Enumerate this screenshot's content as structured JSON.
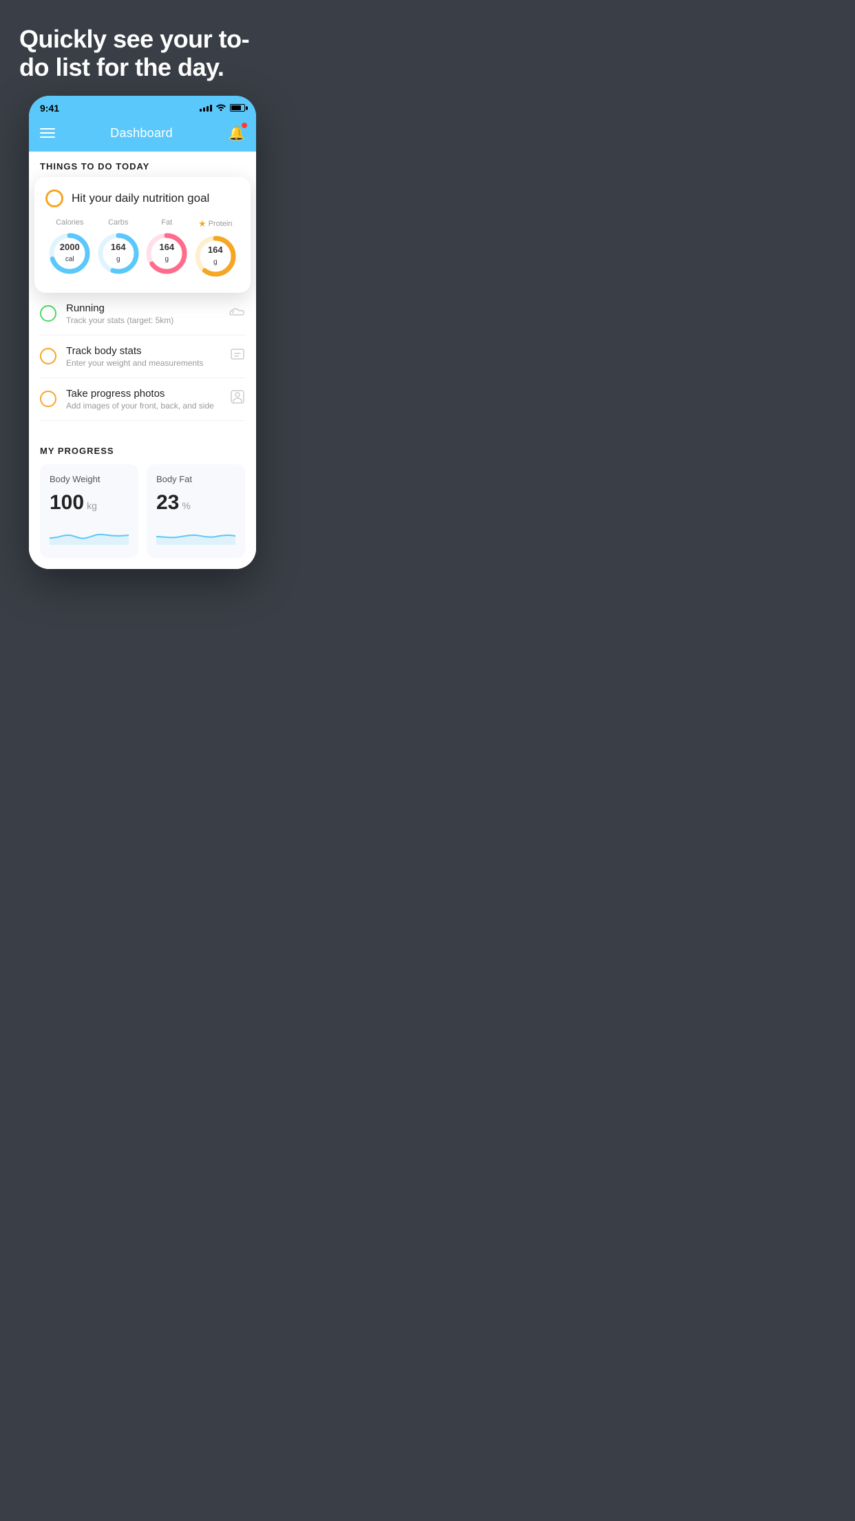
{
  "hero": {
    "title": "Quickly see your to-do list for the day."
  },
  "statusBar": {
    "time": "9:41",
    "signal": "signal",
    "wifi": "wifi",
    "battery": "battery"
  },
  "header": {
    "title": "Dashboard",
    "menu": "menu",
    "bell": "bell"
  },
  "todaySection": {
    "heading": "THINGS TO DO TODAY"
  },
  "nutritionCard": {
    "checkCircle": "circle",
    "title": "Hit your daily nutrition goal",
    "stats": [
      {
        "label": "Calories",
        "value": "2000",
        "unit": "cal",
        "color": "#5ac8fa",
        "trackColor": "#e0f4fd",
        "percent": 70,
        "starred": false
      },
      {
        "label": "Carbs",
        "value": "164",
        "unit": "g",
        "color": "#5ac8fa",
        "trackColor": "#e0f4fd",
        "percent": 55,
        "starred": false
      },
      {
        "label": "Fat",
        "value": "164",
        "unit": "g",
        "color": "#ff6b8a",
        "trackColor": "#ffe0e8",
        "percent": 65,
        "starred": false
      },
      {
        "label": "Protein",
        "value": "164",
        "unit": "g",
        "color": "#f5a623",
        "trackColor": "#fdefd0",
        "percent": 60,
        "starred": true
      }
    ]
  },
  "todoItems": [
    {
      "id": "running",
      "title": "Running",
      "subtitle": "Track your stats (target: 5km)",
      "circleColor": "green",
      "icon": "shoe"
    },
    {
      "id": "track-body",
      "title": "Track body stats",
      "subtitle": "Enter your weight and measurements",
      "circleColor": "yellow",
      "icon": "scale"
    },
    {
      "id": "photos",
      "title": "Take progress photos",
      "subtitle": "Add images of your front, back, and side",
      "circleColor": "yellow",
      "icon": "person"
    }
  ],
  "progressSection": {
    "title": "MY PROGRESS",
    "cards": [
      {
        "id": "body-weight",
        "title": "Body Weight",
        "value": "100",
        "unit": "kg"
      },
      {
        "id": "body-fat",
        "title": "Body Fat",
        "value": "23",
        "unit": "%"
      }
    ]
  }
}
